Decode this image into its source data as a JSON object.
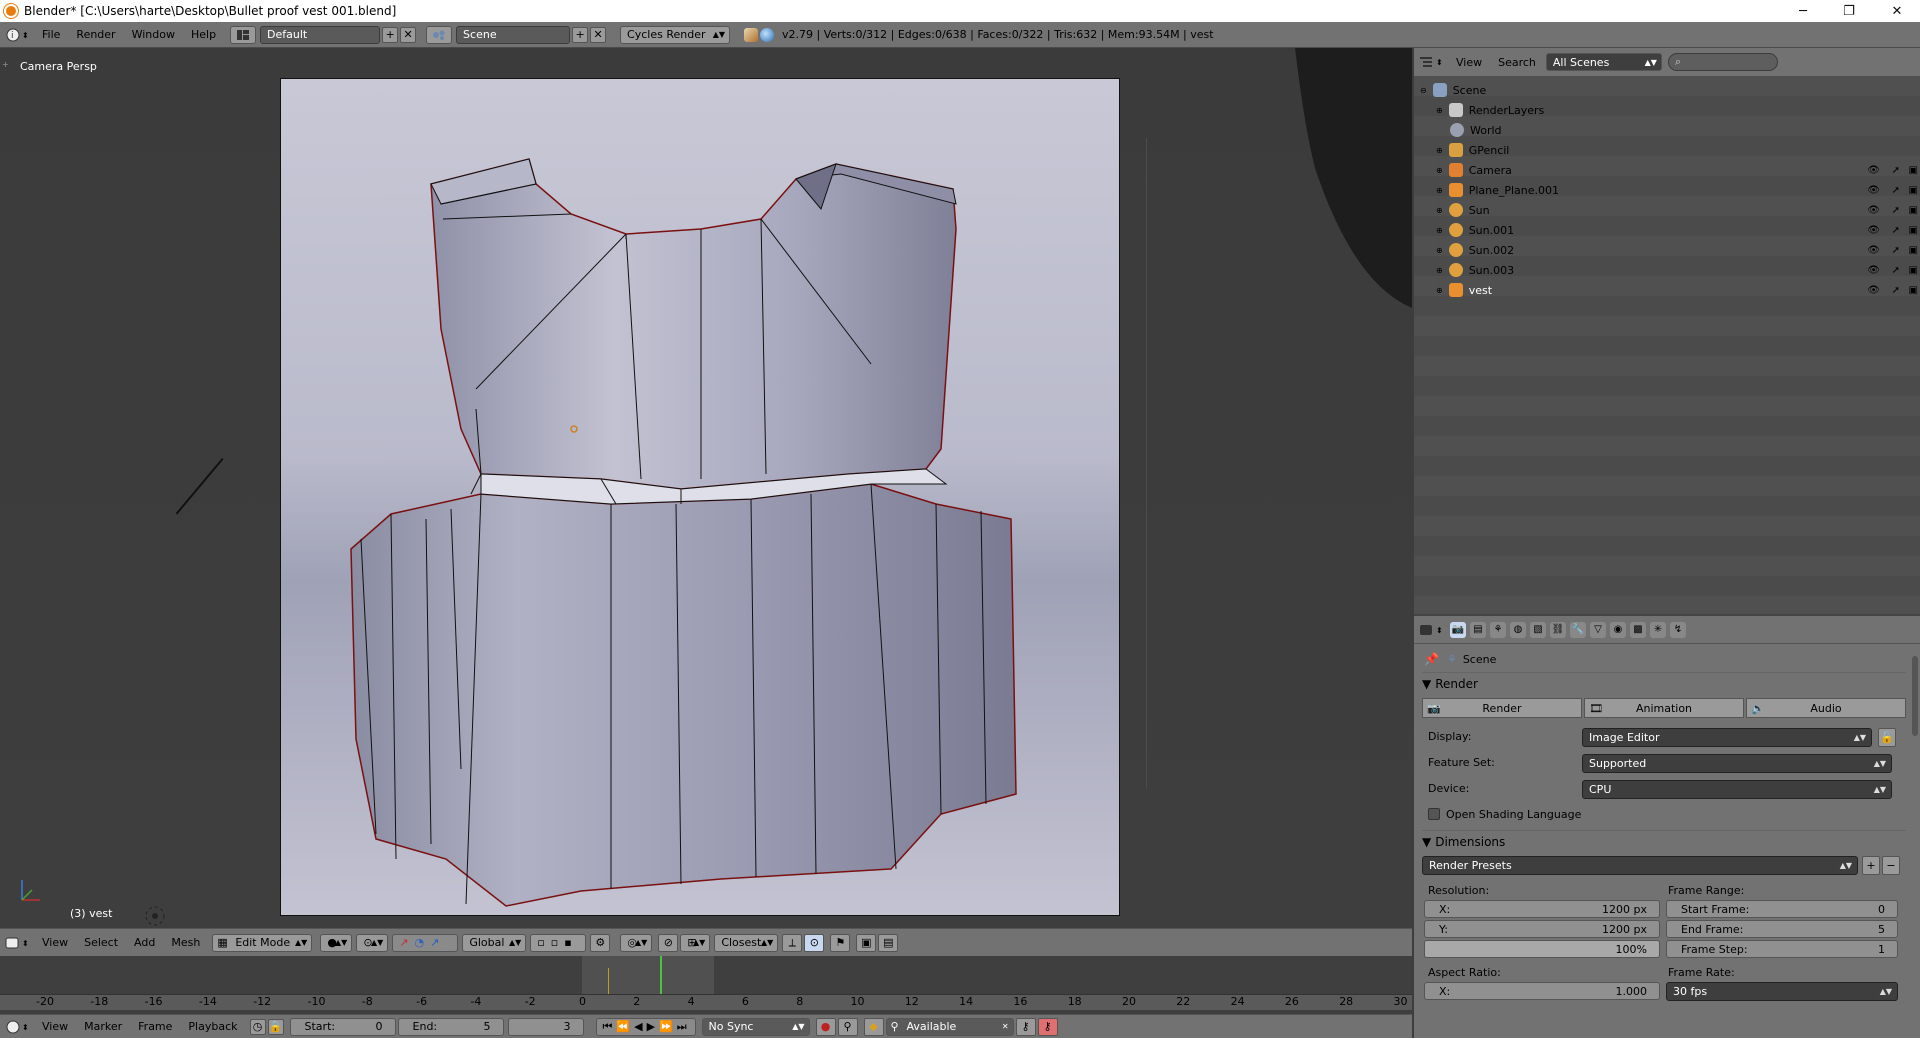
{
  "window": {
    "title": "Blender* [C:\\Users\\harte\\Desktop\\Bullet proof vest 001.blend]",
    "minimize": "─",
    "restore": "❐",
    "close": "✕"
  },
  "info_bar": {
    "menus": [
      "File",
      "Render",
      "Window",
      "Help"
    ],
    "screen_layout": "Default",
    "scene": "Scene",
    "engine": "Cycles Render",
    "stats": "v2.79 | Verts:0/312 | Edges:0/638 | Faces:0/322 | Tris:632 | Mem:93.54M | vest"
  },
  "viewport": {
    "view_label": "Camera Persp",
    "object_label": "(3) vest",
    "header": {
      "menus": [
        "View",
        "Select",
        "Add",
        "Mesh"
      ],
      "mode": "Edit Mode",
      "orientation": "Global",
      "snap": "Closest"
    }
  },
  "timeline": {
    "ticks": [
      "-20",
      "-18",
      "-16",
      "-14",
      "-12",
      "-10",
      "-8",
      "-6",
      "-4",
      "-2",
      "0",
      "2",
      "4",
      "6",
      "8",
      "10",
      "12",
      "14",
      "16",
      "18",
      "20",
      "22",
      "24",
      "26",
      "28",
      "30"
    ],
    "footer": {
      "menus": [
        "View",
        "Marker",
        "Frame",
        "Playback"
      ],
      "start_label": "Start:",
      "start_value": "0",
      "end_label": "End:",
      "end_value": "5",
      "current_frame": "3",
      "sync": "No Sync",
      "keying_set": "Available"
    }
  },
  "outliner": {
    "menus": [
      "View",
      "Search"
    ],
    "filter": "All Scenes",
    "items": [
      {
        "label": "Scene",
        "icon": "scene-icon",
        "color": "#8aa0c0",
        "indent": 0
      },
      {
        "label": "RenderLayers",
        "icon": "renderlayers-icon",
        "color": "#c8c8c8",
        "indent": 1
      },
      {
        "label": "World",
        "icon": "world-icon",
        "color": "#9aa0b0",
        "indent": 1
      },
      {
        "label": "GPencil",
        "icon": "gpencil-icon",
        "color": "#d8a040",
        "indent": 1
      },
      {
        "label": "Camera",
        "icon": "camera-icon",
        "color": "#e08030",
        "indent": 1
      },
      {
        "label": "Plane_Plane.001",
        "icon": "mesh-icon",
        "color": "#e89030",
        "indent": 1
      },
      {
        "label": "Sun",
        "icon": "lamp-icon",
        "color": "#e0a040",
        "indent": 1
      },
      {
        "label": "Sun.001",
        "icon": "lamp-icon",
        "color": "#e0a040",
        "indent": 1
      },
      {
        "label": "Sun.002",
        "icon": "lamp-icon",
        "color": "#e0a040",
        "indent": 1
      },
      {
        "label": "Sun.003",
        "icon": "lamp-icon",
        "color": "#e0a040",
        "indent": 1
      },
      {
        "label": "vest",
        "icon": "mesh-icon",
        "color": "#e89030",
        "indent": 1
      }
    ]
  },
  "properties": {
    "breadcrumb": "Scene",
    "render_panel": {
      "title": "Render",
      "buttons": [
        "Render",
        "Animation",
        "Audio"
      ],
      "display_label": "Display:",
      "display_value": "Image Editor",
      "feature_set_label": "Feature Set:",
      "feature_set_value": "Supported",
      "device_label": "Device:",
      "device_value": "CPU",
      "osl_label": "Open Shading Language"
    },
    "dimensions_panel": {
      "title": "Dimensions",
      "presets": "Render Presets",
      "resolution_label": "Resolution:",
      "res_x_label": "X:",
      "res_x_value": "1200 px",
      "res_y_label": "Y:",
      "res_y_value": "1200 px",
      "res_pct": "100%",
      "frame_range_label": "Frame Range:",
      "start_frame_label": "Start Frame:",
      "start_frame_value": "0",
      "end_frame_label": "End Frame:",
      "end_frame_value": "5",
      "frame_step_label": "Frame Step:",
      "frame_step_value": "1",
      "aspect_label": "Aspect Ratio:",
      "aspect_x_label": "X:",
      "aspect_x_value": "1.000",
      "frame_rate_label": "Frame Rate:",
      "frame_rate_value": "30 fps"
    }
  }
}
